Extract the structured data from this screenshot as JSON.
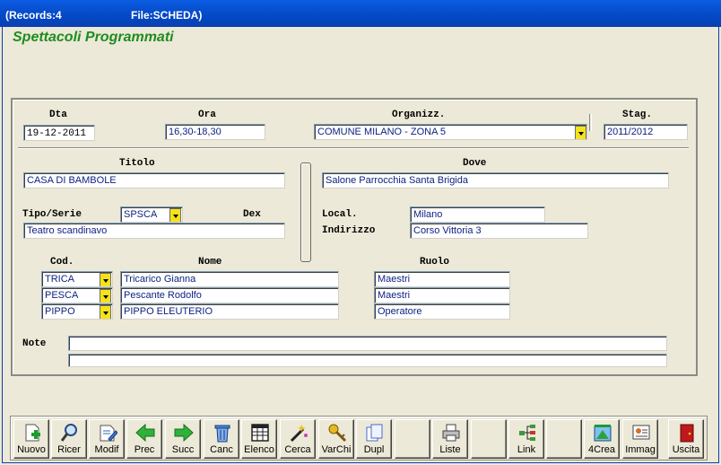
{
  "titlebar": {
    "records": "(Records:4",
    "file": "File:SCHEDA)"
  },
  "form": {
    "title": "Spettacoli Programmati"
  },
  "labels": {
    "dta": "Dta",
    "ora": "Ora",
    "organizz": "Organizz.",
    "stag": "Stag.",
    "titolo": "Titolo",
    "dove": "Dove",
    "tipo_serie": "Tipo/Serie",
    "dex": "Dex",
    "local": "Local.",
    "indirizzo": "Indirizzo",
    "cod": "Cod.",
    "nome": "Nome",
    "ruolo": "Ruolo",
    "note": "Note"
  },
  "fields": {
    "dta": "19-12-2011",
    "ora": "16,30-18,30",
    "organizz": "COMUNE MILANO - ZONA 5",
    "stag": "2011/2012",
    "titolo": "CASA DI BAMBOLE",
    "dove": "Salone Parrocchia Santa Brigida",
    "tipo": "SPSCA",
    "tipo_desc": "Teatro scandinavo",
    "local": "Milano",
    "indirizzo": "Corso Vittoria 3",
    "note1": "",
    "note2": ""
  },
  "people": [
    {
      "cod": "TRICA",
      "nome": "Tricarico Gianna",
      "ruolo": "Maestri"
    },
    {
      "cod": "PESCA",
      "nome": "Pescante Rodolfo",
      "ruolo": "Maestri"
    },
    {
      "cod": "PIPPO",
      "nome": "PIPPO ELEUTERIO",
      "ruolo": "Operatore"
    }
  ],
  "toolbar": {
    "nuovo": "Nuovo",
    "ricer": "Ricer",
    "modif": "Modif",
    "prec": "Prec",
    "succ": "Succ",
    "canc": "Canc",
    "elenco": "Elenco",
    "cerca": "Cerca",
    "varchi": "VarChi",
    "dupl": "Dupl",
    "liste": "Liste",
    "link": "Link",
    "crea": "4Crea",
    "immag": "Immag",
    "uscita": "Uscita"
  },
  "icons": {
    "nuovo": "new-document-icon",
    "ricer": "magnifier-icon",
    "modif": "edit-document-icon",
    "prec": "arrow-left-icon",
    "succ": "arrow-right-icon",
    "canc": "trash-icon",
    "elenco": "grid-list-icon",
    "cerca": "search-wand-icon",
    "varchi": "keys-icon",
    "dupl": "duplicate-icon",
    "liste": "printer-icon",
    "link": "tree-link-icon",
    "crea": "create-icon",
    "immag": "image-card-icon",
    "uscita": "exit-door-icon"
  },
  "colors": {
    "accent": "#1e8c1e",
    "dropdown": "#f5e21a",
    "field_text": "#0a1f80",
    "titlebar": "#0349c6"
  }
}
